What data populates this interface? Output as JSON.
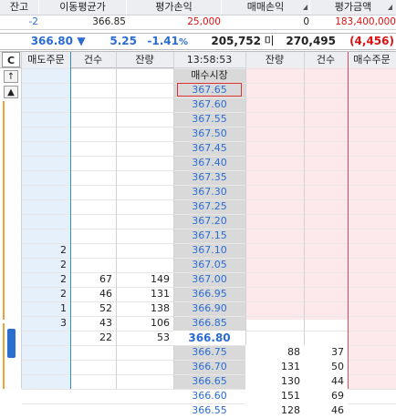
{
  "summary": {
    "headers": [
      "잔고",
      "이동평균가",
      "평가손익",
      "매매손익",
      "평가금액"
    ],
    "values": [
      "-2",
      "366.85",
      "25,000",
      "0",
      "183,400,000"
    ]
  },
  "quote": {
    "price": "366.80",
    "arrow": "▼",
    "change": "5.25",
    "rate": "-1.41",
    "rate_unit": "%",
    "volume": "205,752",
    "mi_label": "미",
    "open_interest": "270,495",
    "oi_change": "(4,456)"
  },
  "grid": {
    "c_label": "C",
    "headers": [
      "매도주문",
      "건수",
      "잔량",
      "13:58:53",
      "잔량",
      "건수",
      "매수주문"
    ],
    "market_label": "매수시장",
    "up_arrow": "↑",
    "up_triangle": "▲",
    "asks": [
      {
        "price": "367.65",
        "order": "",
        "count": "",
        "qty": ""
      },
      {
        "price": "367.60",
        "order": "",
        "count": "",
        "qty": ""
      },
      {
        "price": "367.55",
        "order": "",
        "count": "",
        "qty": ""
      },
      {
        "price": "367.50",
        "order": "",
        "count": "",
        "qty": ""
      },
      {
        "price": "367.45",
        "order": "",
        "count": "",
        "qty": ""
      },
      {
        "price": "367.40",
        "order": "",
        "count": "",
        "qty": ""
      },
      {
        "price": "367.35",
        "order": "",
        "count": "",
        "qty": ""
      },
      {
        "price": "367.30",
        "order": "",
        "count": "",
        "qty": ""
      },
      {
        "price": "367.25",
        "order": "",
        "count": "",
        "qty": ""
      },
      {
        "price": "367.20",
        "order": "",
        "count": "",
        "qty": ""
      },
      {
        "price": "367.15",
        "order": "",
        "count": "",
        "qty": ""
      },
      {
        "price": "367.10",
        "order": "2",
        "count": "",
        "qty": ""
      },
      {
        "price": "367.05",
        "order": "2",
        "count": "",
        "qty": ""
      },
      {
        "price": "367.00",
        "order": "2",
        "count": "67",
        "qty": "149"
      },
      {
        "price": "366.95",
        "order": "2",
        "count": "46",
        "qty": "131"
      },
      {
        "price": "366.90",
        "order": "1",
        "count": "52",
        "qty": "138"
      },
      {
        "price": "366.85",
        "order": "3",
        "count": "43",
        "qty": "106"
      }
    ],
    "current": {
      "price": "366.80",
      "count": "22",
      "qty": "53"
    },
    "bids": [
      {
        "price": "366.75",
        "qty": "88",
        "count": "37"
      },
      {
        "price": "366.70",
        "qty": "131",
        "count": "50"
      },
      {
        "price": "366.65",
        "qty": "130",
        "count": "44"
      },
      {
        "price": "366.60",
        "qty": "151",
        "count": "69"
      },
      {
        "price": "366.55",
        "qty": "128",
        "count": "46"
      }
    ]
  }
}
